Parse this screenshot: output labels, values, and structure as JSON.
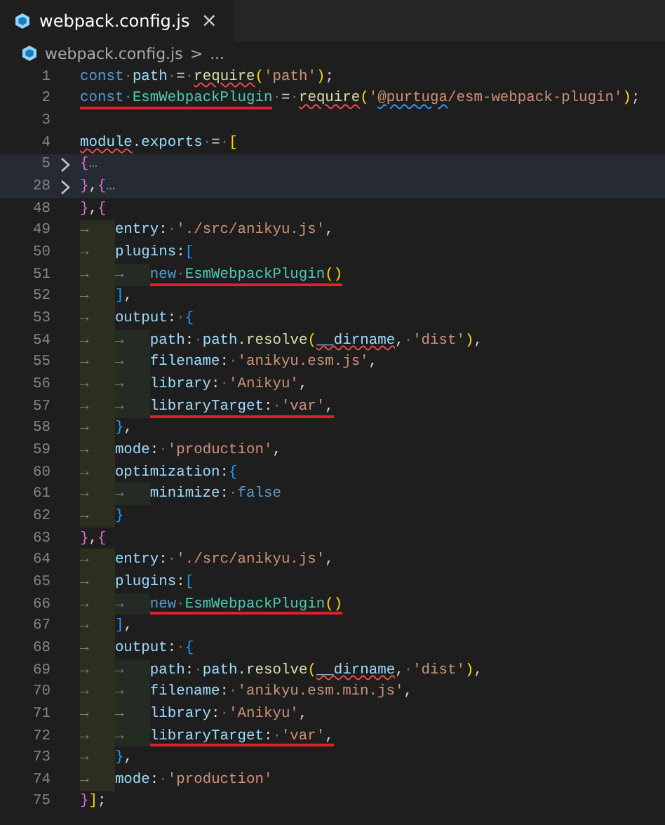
{
  "tab": {
    "title": "webpack.config.js",
    "close": "×",
    "selected": true
  },
  "breadcrumb": {
    "file": "webpack.config.js",
    "separator": ">",
    "rest": "..."
  },
  "lines": [
    {
      "number": "1",
      "folded": false,
      "highlighted": false,
      "tokens": [
        {
          "kind": "kw",
          "text": "const"
        },
        {
          "kind": "p",
          "text": "·"
        },
        {
          "kind": "var",
          "text": "path"
        },
        {
          "kind": "p",
          "text": "·=·"
        },
        {
          "kind": "fn",
          "text": "require",
          "error_squiggle": true
        },
        {
          "kind": "b1",
          "text": "("
        },
        {
          "kind": "str",
          "text": "'path'"
        },
        {
          "kind": "b1",
          "text": ")"
        },
        {
          "kind": "p",
          "text": ";"
        }
      ]
    },
    {
      "number": "2",
      "folded": false,
      "highlighted": false,
      "tokens": [
        {
          "kind": "mark",
          "tokens": [
            {
              "kind": "kw",
              "text": "const"
            },
            {
              "kind": "p",
              "text": "·"
            },
            {
              "kind": "cls",
              "text": "EsmWebpackPlugin"
            }
          ]
        },
        {
          "kind": "p",
          "text": "·=·"
        },
        {
          "kind": "fn",
          "text": "require",
          "error_squiggle": true
        },
        {
          "kind": "b1",
          "text": "("
        },
        {
          "kind": "str",
          "text": "'"
        },
        {
          "kind": "str",
          "text": "@purtuga",
          "info_squiggle": true
        },
        {
          "kind": "str",
          "text": "/esm-webpack-plugin'"
        },
        {
          "kind": "b1",
          "text": ")"
        },
        {
          "kind": "p",
          "text": ";"
        }
      ]
    },
    {
      "number": "3",
      "folded": false,
      "highlighted": false
    },
    {
      "number": "4",
      "folded": false,
      "highlighted": false,
      "tokens": [
        {
          "kind": "var",
          "text": "module",
          "error_squiggle": true
        },
        {
          "kind": "p",
          "text": "."
        },
        {
          "kind": "var",
          "text": "exports"
        },
        {
          "kind": "p",
          "text": "·=·"
        },
        {
          "kind": "b1",
          "text": "["
        }
      ]
    },
    {
      "number": "5",
      "folded": true,
      "highlighted": true,
      "tokens": [
        {
          "kind": "b2",
          "text": "{"
        },
        {
          "kind": "fold",
          "text": "…"
        }
      ]
    },
    {
      "number": "28",
      "folded": true,
      "highlighted": true,
      "tokens": [
        {
          "kind": "b2",
          "text": "}"
        },
        {
          "kind": "p",
          "text": ","
        },
        {
          "kind": "b2",
          "text": "{"
        },
        {
          "kind": "fold",
          "text": "…"
        }
      ]
    },
    {
      "number": "48",
      "folded": false,
      "highlighted": false,
      "tokens": [
        {
          "kind": "b2",
          "text": "}"
        },
        {
          "kind": "p",
          "text": ","
        },
        {
          "kind": "b2",
          "text": "{"
        }
      ]
    },
    {
      "number": "49",
      "folded": false,
      "highlighted": false,
      "tokens": [
        {
          "kind": "indent",
          "text": "→"
        },
        {
          "kind": "var",
          "text": "entry"
        },
        {
          "kind": "p",
          "text": ":·"
        },
        {
          "kind": "str",
          "text": "'./src/anikyu.js'"
        },
        {
          "kind": "p",
          "text": ","
        }
      ]
    },
    {
      "number": "50",
      "folded": false,
      "highlighted": false,
      "tokens": [
        {
          "kind": "indent",
          "text": "→"
        },
        {
          "kind": "var",
          "text": "plugins"
        },
        {
          "kind": "p",
          "text": ":"
        },
        {
          "kind": "b3",
          "text": "["
        }
      ]
    },
    {
      "number": "51",
      "folded": false,
      "highlighted": false,
      "tokens": [
        {
          "kind": "indent",
          "text": "→"
        },
        {
          "kind": "indent",
          "text": "→"
        },
        {
          "kind": "mark",
          "tokens": [
            {
              "kind": "kw",
              "text": "new"
            },
            {
              "kind": "p",
              "text": "·"
            },
            {
              "kind": "cls",
              "text": "EsmWebpackPlugin"
            },
            {
              "kind": "b1",
              "text": "()"
            }
          ]
        }
      ]
    },
    {
      "number": "52",
      "folded": false,
      "highlighted": false,
      "tokens": [
        {
          "kind": "indent",
          "text": "→"
        },
        {
          "kind": "b3",
          "text": "]"
        },
        {
          "kind": "p",
          "text": ","
        }
      ]
    },
    {
      "number": "53",
      "folded": false,
      "highlighted": false,
      "tokens": [
        {
          "kind": "indent",
          "text": "→"
        },
        {
          "kind": "var",
          "text": "output"
        },
        {
          "kind": "p",
          "text": ":·"
        },
        {
          "kind": "b3",
          "text": "{"
        }
      ]
    },
    {
      "number": "54",
      "folded": false,
      "highlighted": false,
      "tokens": [
        {
          "kind": "indent",
          "text": "→"
        },
        {
          "kind": "indent",
          "text": "→"
        },
        {
          "kind": "var",
          "text": "path"
        },
        {
          "kind": "p",
          "text": ":·"
        },
        {
          "kind": "var",
          "text": "path"
        },
        {
          "kind": "p",
          "text": "."
        },
        {
          "kind": "fn",
          "text": "resolve"
        },
        {
          "kind": "b1",
          "text": "("
        },
        {
          "kind": "var",
          "text": "__dirname",
          "error_squiggle": true
        },
        {
          "kind": "p",
          "text": ",·"
        },
        {
          "kind": "str",
          "text": "'dist'"
        },
        {
          "kind": "b1",
          "text": ")"
        },
        {
          "kind": "p",
          "text": ","
        }
      ]
    },
    {
      "number": "55",
      "folded": false,
      "highlighted": false,
      "tokens": [
        {
          "kind": "indent",
          "text": "→"
        },
        {
          "kind": "indent",
          "text": "→"
        },
        {
          "kind": "var",
          "text": "filename"
        },
        {
          "kind": "p",
          "text": ":·"
        },
        {
          "kind": "str",
          "text": "'anikyu.esm.js'"
        },
        {
          "kind": "p",
          "text": ","
        }
      ]
    },
    {
      "number": "56",
      "folded": false,
      "highlighted": false,
      "tokens": [
        {
          "kind": "indent",
          "text": "→"
        },
        {
          "kind": "indent",
          "text": "→"
        },
        {
          "kind": "var",
          "text": "library"
        },
        {
          "kind": "p",
          "text": ":·"
        },
        {
          "kind": "str",
          "text": "'Anikyu'"
        },
        {
          "kind": "p",
          "text": ","
        }
      ]
    },
    {
      "number": "57",
      "folded": false,
      "highlighted": false,
      "tokens": [
        {
          "kind": "indent",
          "text": "→"
        },
        {
          "kind": "indent",
          "text": "→"
        },
        {
          "kind": "mark",
          "tokens": [
            {
              "kind": "var",
              "text": "libraryTarget"
            },
            {
              "kind": "p",
              "text": ":·"
            },
            {
              "kind": "str",
              "text": "'var'"
            },
            {
              "kind": "p",
              "text": ","
            }
          ]
        }
      ]
    },
    {
      "number": "58",
      "folded": false,
      "highlighted": false,
      "tokens": [
        {
          "kind": "indent",
          "text": "→"
        },
        {
          "kind": "b3",
          "text": "}"
        },
        {
          "kind": "p",
          "text": ","
        }
      ]
    },
    {
      "number": "59",
      "folded": false,
      "highlighted": false,
      "tokens": [
        {
          "kind": "indent",
          "text": "→"
        },
        {
          "kind": "var",
          "text": "mode"
        },
        {
          "kind": "p",
          "text": ":·"
        },
        {
          "kind": "str",
          "text": "'production'"
        },
        {
          "kind": "p",
          "text": ","
        }
      ]
    },
    {
      "number": "60",
      "folded": false,
      "highlighted": false,
      "tokens": [
        {
          "kind": "indent",
          "text": "→"
        },
        {
          "kind": "var",
          "text": "optimization"
        },
        {
          "kind": "p",
          "text": ":"
        },
        {
          "kind": "b3",
          "text": "{"
        }
      ]
    },
    {
      "number": "61",
      "folded": false,
      "highlighted": false,
      "tokens": [
        {
          "kind": "indent",
          "text": "→"
        },
        {
          "kind": "indent",
          "text": "→"
        },
        {
          "kind": "var",
          "text": "minimize"
        },
        {
          "kind": "p",
          "text": ":·"
        },
        {
          "kind": "kw",
          "text": "false"
        }
      ]
    },
    {
      "number": "62",
      "folded": false,
      "highlighted": false,
      "tokens": [
        {
          "kind": "indent",
          "text": "→"
        },
        {
          "kind": "b3",
          "text": "}"
        }
      ]
    },
    {
      "number": "63",
      "folded": false,
      "highlighted": false,
      "tokens": [
        {
          "kind": "b2",
          "text": "}"
        },
        {
          "kind": "p",
          "text": ","
        },
        {
          "kind": "b2",
          "text": "{"
        }
      ]
    },
    {
      "number": "64",
      "folded": false,
      "highlighted": false,
      "tokens": [
        {
          "kind": "indent",
          "text": "→"
        },
        {
          "kind": "var",
          "text": "entry"
        },
        {
          "kind": "p",
          "text": ":·"
        },
        {
          "kind": "str",
          "text": "'./src/anikyu.js'"
        },
        {
          "kind": "p",
          "text": ","
        }
      ]
    },
    {
      "number": "65",
      "folded": false,
      "highlighted": false,
      "tokens": [
        {
          "kind": "indent",
          "text": "→"
        },
        {
          "kind": "var",
          "text": "plugins"
        },
        {
          "kind": "p",
          "text": ":"
        },
        {
          "kind": "b3",
          "text": "["
        }
      ]
    },
    {
      "number": "66",
      "folded": false,
      "highlighted": false,
      "tokens": [
        {
          "kind": "indent",
          "text": "→"
        },
        {
          "kind": "indent",
          "text": "→"
        },
        {
          "kind": "mark",
          "tokens": [
            {
              "kind": "kw",
              "text": "new"
            },
            {
              "kind": "p",
              "text": "·"
            },
            {
              "kind": "cls",
              "text": "EsmWebpackPlugin"
            },
            {
              "kind": "b1",
              "text": "()"
            }
          ]
        }
      ]
    },
    {
      "number": "67",
      "folded": false,
      "highlighted": false,
      "tokens": [
        {
          "kind": "indent",
          "text": "→"
        },
        {
          "kind": "b3",
          "text": "]"
        },
        {
          "kind": "p",
          "text": ","
        }
      ]
    },
    {
      "number": "68",
      "folded": false,
      "highlighted": false,
      "tokens": [
        {
          "kind": "indent",
          "text": "→"
        },
        {
          "kind": "var",
          "text": "output"
        },
        {
          "kind": "p",
          "text": ":·"
        },
        {
          "kind": "b3",
          "text": "{"
        }
      ]
    },
    {
      "number": "69",
      "folded": false,
      "highlighted": false,
      "tokens": [
        {
          "kind": "indent",
          "text": "→"
        },
        {
          "kind": "indent",
          "text": "→"
        },
        {
          "kind": "var",
          "text": "path"
        },
        {
          "kind": "p",
          "text": ":·"
        },
        {
          "kind": "var",
          "text": "path"
        },
        {
          "kind": "p",
          "text": "."
        },
        {
          "kind": "fn",
          "text": "resolve"
        },
        {
          "kind": "b1",
          "text": "("
        },
        {
          "kind": "var",
          "text": "__dirname",
          "error_squiggle": true
        },
        {
          "kind": "p",
          "text": ",·"
        },
        {
          "kind": "str",
          "text": "'dist'"
        },
        {
          "kind": "b1",
          "text": ")"
        },
        {
          "kind": "p",
          "text": ","
        }
      ]
    },
    {
      "number": "70",
      "folded": false,
      "highlighted": false,
      "tokens": [
        {
          "kind": "indent",
          "text": "→"
        },
        {
          "kind": "indent",
          "text": "→"
        },
        {
          "kind": "var",
          "text": "filename"
        },
        {
          "kind": "p",
          "text": ":·"
        },
        {
          "kind": "str",
          "text": "'anikyu.esm.min.js'"
        },
        {
          "kind": "p",
          "text": ","
        }
      ]
    },
    {
      "number": "71",
      "folded": false,
      "highlighted": false,
      "tokens": [
        {
          "kind": "indent",
          "text": "→"
        },
        {
          "kind": "indent",
          "text": "→"
        },
        {
          "kind": "var",
          "text": "library"
        },
        {
          "kind": "p",
          "text": ":·"
        },
        {
          "kind": "str",
          "text": "'Anikyu'"
        },
        {
          "kind": "p",
          "text": ","
        }
      ]
    },
    {
      "number": "72",
      "folded": false,
      "highlighted": false,
      "tokens": [
        {
          "kind": "indent",
          "text": "→"
        },
        {
          "kind": "indent",
          "text": "→"
        },
        {
          "kind": "mark",
          "tokens": [
            {
              "kind": "var",
              "text": "libraryTarget"
            },
            {
              "kind": "p",
              "text": ":·"
            },
            {
              "kind": "str",
              "text": "'var'"
            },
            {
              "kind": "p",
              "text": ","
            }
          ]
        }
      ]
    },
    {
      "number": "73",
      "folded": false,
      "highlighted": false,
      "tokens": [
        {
          "kind": "indent",
          "text": "→"
        },
        {
          "kind": "b3",
          "text": "}"
        },
        {
          "kind": "p",
          "text": ","
        }
      ]
    },
    {
      "number": "74",
      "folded": false,
      "highlighted": false,
      "tokens": [
        {
          "kind": "indent",
          "text": "→"
        },
        {
          "kind": "var",
          "text": "mode"
        },
        {
          "kind": "p",
          "text": ":·"
        },
        {
          "kind": "str",
          "text": "'production'"
        }
      ]
    },
    {
      "number": "75",
      "folded": false,
      "highlighted": false,
      "tokens": [
        {
          "kind": "b2",
          "text": "}"
        },
        {
          "kind": "b1",
          "text": "]"
        },
        {
          "kind": "p",
          "text": ";"
        }
      ]
    }
  ]
}
